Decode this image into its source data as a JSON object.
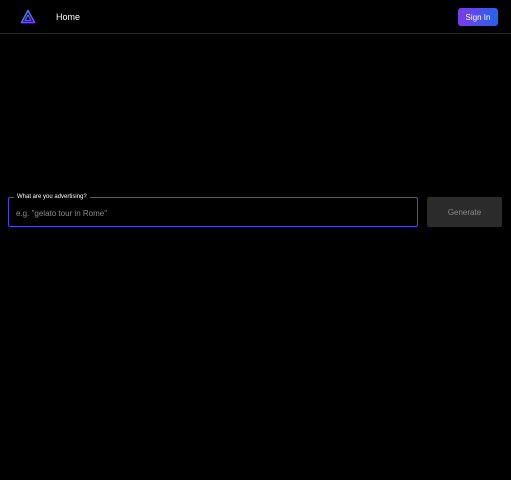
{
  "header": {
    "logo_icon": "triangle-logo-icon",
    "nav_home_label": "Home",
    "sign_in_label": "Sign In"
  },
  "prompt": {
    "label": "What are you advertising?",
    "placeholder": "e.g. \"gelato tour in Rome\"",
    "value": ""
  },
  "actions": {
    "generate_label": "Generate"
  },
  "colors": {
    "background": "#000000",
    "field_border": "#5b3fe0",
    "signin_gradient_start": "#7c3aed",
    "signin_gradient_end": "#2563eb",
    "disabled_button": "#2b2b2b",
    "logo_start": "#3b82f6",
    "logo_end": "#7c3aed"
  }
}
